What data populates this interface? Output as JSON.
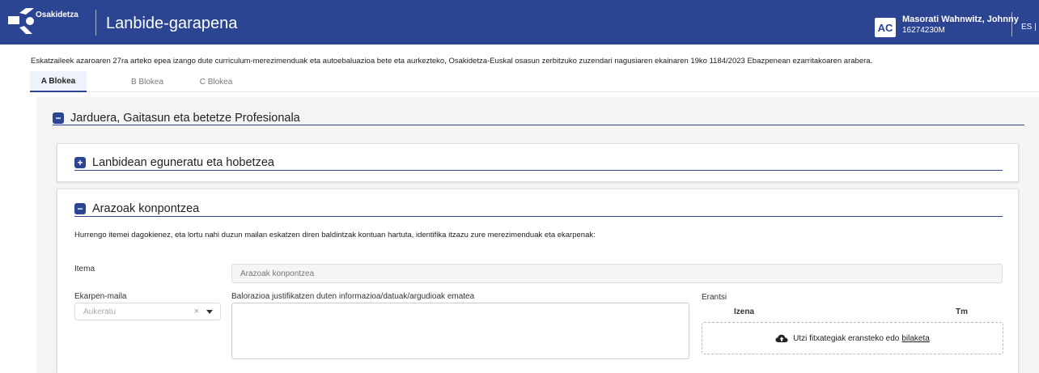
{
  "header": {
    "logo_text": "Osakidetza",
    "app_title": "Lanbide-garapena",
    "avatar_initials": "AC",
    "user_name": "Masorati Wahnwitz, Johnny",
    "user_id": "16274230M",
    "language": "ES |"
  },
  "notice": "Eskatzaileek azaroaren 27ra arteko epea izango dute curriculum-merezimenduak eta autoebaluazioa bete eta aurkezteko, Osakidetza-Euskal osasun zerbitzuko zuzendari nagusiaren ekainaren 19ko 1184/2023 Ebazpenean ezarritakoaren arabera.",
  "tabs": [
    {
      "label": "A Blokea",
      "active": true
    },
    {
      "label": "B Blokea",
      "active": false
    },
    {
      "label": "C Blokea",
      "active": false
    }
  ],
  "main_section": {
    "title": "Jarduera, Gaitasun eta betetze Profesionala",
    "icon": "minus-square-icon"
  },
  "subsection_1": {
    "title": "Lanbidean eguneratu eta hobetzea",
    "icon": "plus-square-icon"
  },
  "subsection_2": {
    "title": "Arazoak konpontzea",
    "icon": "minus-square-icon",
    "intro": "Hurrengo itemei dagokienez, eta lortu nahi duzun mailan eskatzen diren baldintzak kontuan hartuta, identifika itzazu zure merezimenduak eta ekarpenak:",
    "item_label": "Itema",
    "item_value": "Arazoak konpontzea",
    "level_label": "Ekarpen-maila",
    "level_placeholder": "Aukeratu",
    "justification_label": "Balorazioa justifikatzen duten informazioa/datuak/argudioak ematea",
    "attach_label": "Erantsi",
    "col_name": "Izena",
    "col_size": "Tm",
    "drop_text": "Utzi fitxategiak eransteko edo",
    "drop_link": "bilaketa"
  },
  "colors": {
    "brand": "#2b4592",
    "panel": "#f4f4f4"
  }
}
